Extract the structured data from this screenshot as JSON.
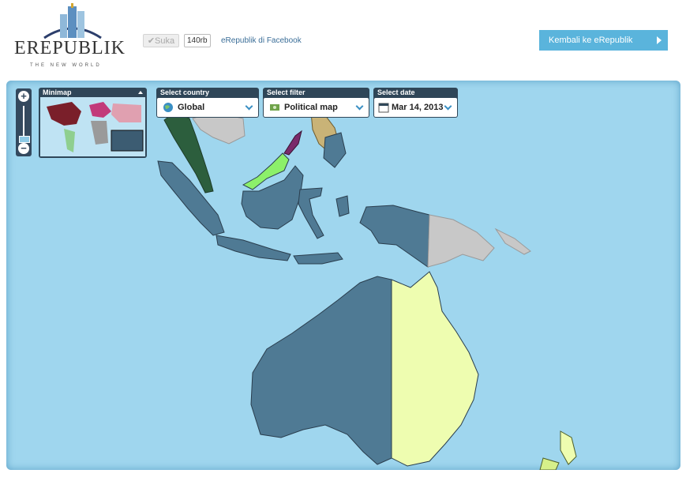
{
  "header": {
    "logo_text": "EREPUBLIK",
    "logo_tagline": "THE NEW WORLD",
    "like_label": "✔Suka",
    "like_count": "140rb",
    "facebook_link": "eRepublik di Facebook",
    "back_button": "Kembali ke eRepublik"
  },
  "controls": {
    "minimap_title": "Minimap",
    "country": {
      "title": "Select country",
      "value": "Global",
      "icon": "globe-icon"
    },
    "filter": {
      "title": "Select filter",
      "value": "Political map",
      "icon": "money-icon"
    },
    "date": {
      "title": "Select date",
      "value": "Mar 14, 2013",
      "icon": "calendar-icon"
    },
    "zoom_in": "+",
    "zoom_out": "−"
  },
  "colors": {
    "sea": "#9fd6ee",
    "indonesia": "#4f7a94",
    "australia_west": "#4f7a94",
    "australia_east": "#eefdb0",
    "malaysia": "#8cf06a",
    "thailand": "#2c5e3d",
    "philippines": "#c9b377",
    "png": "#c8c8c8",
    "new_zealand": "#d6f08a",
    "panel": "#2f4658",
    "accent_button": "#5ab4dc"
  }
}
